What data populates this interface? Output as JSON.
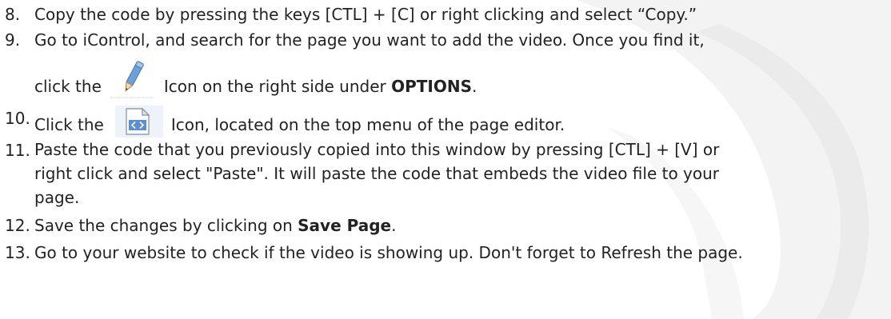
{
  "items": [
    {
      "number": "8.",
      "text": "Copy the code by pressing the keys [CTL] + [C] or right clicking and select “Copy.”"
    },
    {
      "number": "9.",
      "line1": "Go to iControl, and search for the page you want to add the video.  Once you find it,",
      "pre_icon": "click the",
      "icon": "pencil-icon",
      "post_icon": "Icon on the right side under",
      "bold": "OPTIONS",
      "end": "."
    },
    {
      "number": "10.",
      "pre_icon": "Click the",
      "icon": "html-source-icon",
      "post_icon": "Icon, located on the top menu of the page editor."
    },
    {
      "number": "11.",
      "lines": [
        "Paste the code that you previously copied into this window by pressing [CTL] + [V] or",
        "right click and select \"Paste\". It will paste the code that embeds the video file to your",
        "page."
      ]
    },
    {
      "number": "12.",
      "text": "Save the changes by clicking on",
      "bold": "Save Page",
      "end": "."
    },
    {
      "number": "13.",
      "text": "Go to your website to check if the video is showing up. Don't forget to Refresh the page."
    }
  ],
  "colors": {
    "text": "#222222",
    "watermark": "#f0f0f0",
    "icon_blue": "#5b8fd1"
  }
}
